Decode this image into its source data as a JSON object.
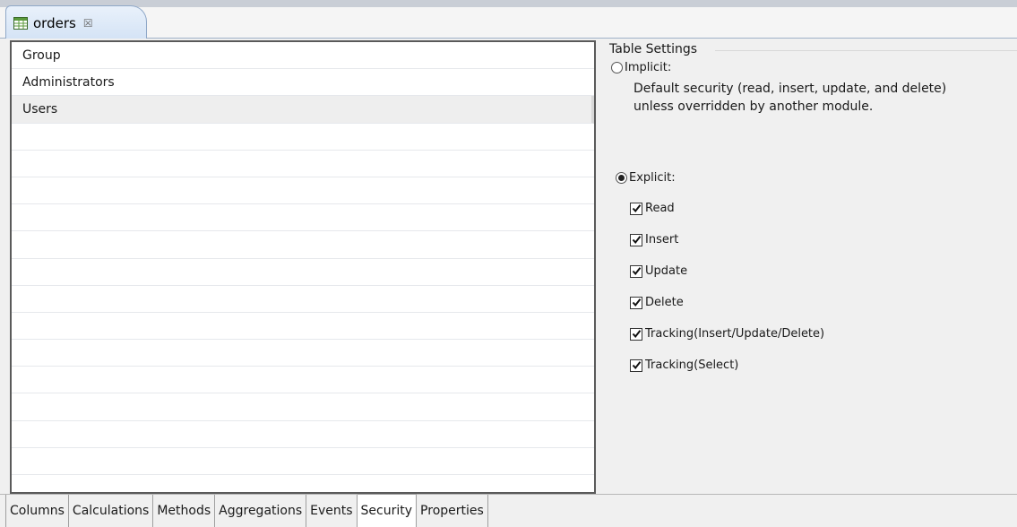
{
  "editor_tab": {
    "title": "orders",
    "close_glyph": "☒",
    "icon": "table-icon"
  },
  "group_table": {
    "rows": [
      "Group",
      "Administrators",
      "Users",
      "",
      "",
      "",
      "",
      "",
      "",
      "",
      "",
      "",
      "",
      "",
      "",
      "",
      ""
    ],
    "selected_row": "Users"
  },
  "settings": {
    "title": "Table Settings",
    "implicit": {
      "label": "Implicit:",
      "selected": false,
      "description_line1": "Default security (read, insert, update, and delete)",
      "description_line2": "unless overridden by another module."
    },
    "explicit": {
      "label": "Explicit:",
      "selected": true
    },
    "checkboxes": [
      {
        "label": "Read",
        "checked": true
      },
      {
        "label": "Insert",
        "checked": true
      },
      {
        "label": "Update",
        "checked": true
      },
      {
        "label": "Delete",
        "checked": true
      },
      {
        "label": "Tracking(Insert/Update/Delete)",
        "checked": true
      },
      {
        "label": "Tracking(Select)",
        "checked": true
      }
    ]
  },
  "bottom_tabs": [
    {
      "label": "Columns",
      "active": false
    },
    {
      "label": "Calculations",
      "active": false
    },
    {
      "label": "Methods",
      "active": false
    },
    {
      "label": "Aggregations",
      "active": false
    },
    {
      "label": "Events",
      "active": false
    },
    {
      "label": "Security",
      "active": true
    },
    {
      "label": "Properties",
      "active": false
    }
  ],
  "colors": {
    "tab_border": "#8fa8c8",
    "table_border": "#5a5a5a",
    "background": "#f0f0f0"
  }
}
